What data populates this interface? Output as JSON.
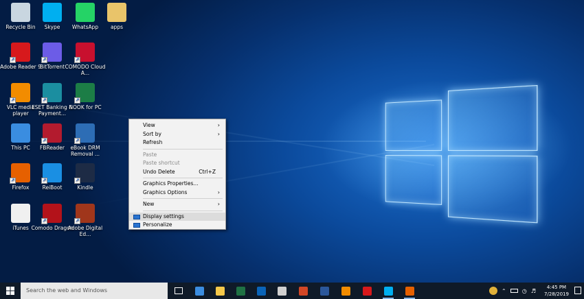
{
  "desktop_icons": [
    {
      "label": "Recycle Bin",
      "icon": "recycle-bin-icon",
      "color": "#c9d6e0"
    },
    {
      "label": "Skype",
      "icon": "skype-icon",
      "color": "#00aff0"
    },
    {
      "label": "WhatsApp",
      "icon": "whatsapp-icon",
      "color": "#25d366"
    },
    {
      "label": "apps",
      "icon": "folder-icon",
      "color": "#e9c46a"
    },
    {
      "label": "Adobe Reader 9",
      "icon": "adobe-reader-icon",
      "color": "#d7191c"
    },
    {
      "label": "BitTorrent",
      "icon": "bittorrent-icon",
      "color": "#6c5ce7"
    },
    {
      "label": "COMODO Cloud A...",
      "icon": "comodo-cloud-icon",
      "color": "#c8102e"
    },
    {
      "label": "VLC media player",
      "icon": "vlc-icon",
      "color": "#f28c00"
    },
    {
      "label": "ESET Banking & Payment...",
      "icon": "eset-icon",
      "color": "#1b8ea0"
    },
    {
      "label": "NOOK for PC",
      "icon": "nook-icon",
      "color": "#1c7d46"
    },
    {
      "label": "This PC",
      "icon": "this-pc-icon",
      "color": "#3a8de0"
    },
    {
      "label": "FBReader",
      "icon": "fbreader-icon",
      "color": "#b31b2e"
    },
    {
      "label": "eBook DRM Removal ...",
      "icon": "ebook-drm-icon",
      "color": "#2d6db5"
    },
    {
      "label": "Firefox",
      "icon": "firefox-icon",
      "color": "#e66000"
    },
    {
      "label": "ReiBoot",
      "icon": "reiboot-icon",
      "color": "#1a8fe3"
    },
    {
      "label": "Kindle",
      "icon": "kindle-icon",
      "color": "#1d2b45"
    },
    {
      "label": "iTunes",
      "icon": "itunes-icon",
      "color": "#f0f0f0"
    },
    {
      "label": "Comodo Dragon",
      "icon": "comodo-dragon-icon",
      "color": "#b3121a"
    },
    {
      "label": "Adobe Digital Ed...",
      "icon": "adobe-digital-editions-icon",
      "color": "#a0361b"
    }
  ],
  "context_menu": {
    "items": [
      {
        "label": "View",
        "submenu": true
      },
      {
        "label": "Sort by",
        "submenu": true
      },
      {
        "label": "Refresh"
      },
      {
        "sep": true
      },
      {
        "label": "Paste",
        "disabled": true
      },
      {
        "label": "Paste shortcut",
        "disabled": true
      },
      {
        "label": "Undo Delete",
        "shortcut": "Ctrl+Z"
      },
      {
        "sep": true
      },
      {
        "label": "Graphics Properties..."
      },
      {
        "label": "Graphics Options",
        "submenu": true
      },
      {
        "sep": true
      },
      {
        "label": "New",
        "submenu": true
      },
      {
        "sep": true
      },
      {
        "label": "Display settings",
        "highlighted": true,
        "icon": "display-icon"
      },
      {
        "label": "Personalize",
        "icon": "personalize-icon"
      }
    ]
  },
  "taskbar": {
    "search_placeholder": "Search the web and Windows",
    "apps": [
      {
        "icon": "task-view-icon",
        "color": "#ffffff"
      },
      {
        "icon": "edge-icon",
        "color": "#3b8de0"
      },
      {
        "icon": "file-explorer-icon",
        "color": "#f4c84a"
      },
      {
        "icon": "excel-icon",
        "color": "#1f7244"
      },
      {
        "icon": "outlook-icon",
        "color": "#0a64b8"
      },
      {
        "icon": "calculator-icon",
        "color": "#d0d0d0"
      },
      {
        "icon": "powerpoint-icon",
        "color": "#d24726"
      },
      {
        "icon": "word-icon",
        "color": "#2b579a"
      },
      {
        "icon": "vlc-icon",
        "color": "#f28c00"
      },
      {
        "icon": "adobe-reader-icon",
        "color": "#d7191c"
      },
      {
        "icon": "skype-icon",
        "color": "#00aff0"
      },
      {
        "icon": "firefox-icon",
        "color": "#e66000"
      }
    ],
    "time": "4:45 PM",
    "date": "7/28/2019"
  }
}
